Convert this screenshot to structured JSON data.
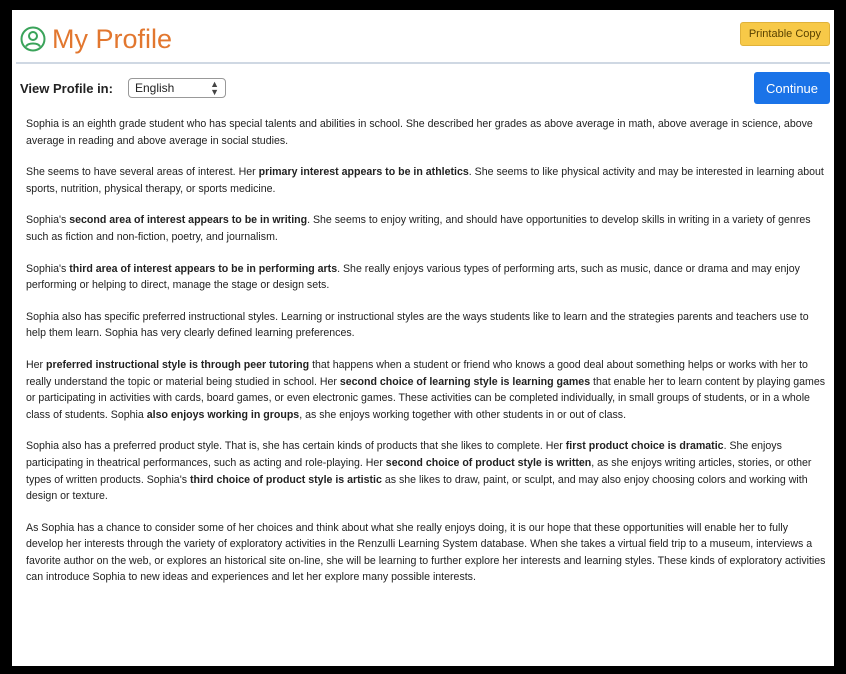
{
  "header": {
    "title": "My Profile",
    "printable_label": "Printable Copy",
    "title_color": "#e2772f",
    "icon": "user-circle-icon"
  },
  "toolbar": {
    "view_label": "View Profile in:",
    "language_selected": "English",
    "continue_label": "Continue",
    "continue_color": "#1a73e8"
  },
  "paragraphs": [
    [
      {
        "t": "Sophia is an eighth grade student who has special talents and abilities in school. She described her grades as above average in math, above average in science, above average in reading and above average in social studies."
      }
    ],
    [
      {
        "t": "She seems to have several areas of interest. Her "
      },
      {
        "t": "primary interest appears to be in athletics",
        "b": true
      },
      {
        "t": ". She seems to like physical activity and may be interested in learning about sports, nutrition, physical therapy, or sports medicine."
      }
    ],
    [
      {
        "t": "Sophia's "
      },
      {
        "t": "second area of interest appears to be in writing",
        "b": true
      },
      {
        "t": ". She seems to enjoy writing, and should have opportunities to develop skills in writing in a variety of genres such as fiction and non-fiction, poetry, and journalism."
      }
    ],
    [
      {
        "t": "Sophia's "
      },
      {
        "t": "third area of interest appears to be in performing arts",
        "b": true
      },
      {
        "t": ". She really enjoys various types of performing arts, such as music, dance or drama and may enjoy performing or helping to direct, manage the stage or design sets."
      }
    ],
    [
      {
        "t": "Sophia also has specific preferred instructional styles. Learning or instructional styles are the ways students like to learn and the strategies parents and teachers use to help them learn. Sophia has very clearly defined learning preferences."
      }
    ],
    [
      {
        "t": "Her "
      },
      {
        "t": "preferred instructional style is through peer tutoring",
        "b": true
      },
      {
        "t": " that happens when a student or friend who knows a good deal about something helps or works with her to really understand the topic or material being studied in school. Her "
      },
      {
        "t": "second choice of learning style is learning games",
        "b": true
      },
      {
        "t": " that enable her to learn content by playing games or participating in activities with cards, board games, or even electronic games. These activities can be completed individually, in small groups of students, or in a whole class of students. Sophia "
      },
      {
        "t": "also enjoys working in groups",
        "b": true
      },
      {
        "t": ", as she enjoys working together with other students in or out of class."
      }
    ],
    [
      {
        "t": "Sophia also has a preferred product style. That is, she has certain kinds of products that she likes to complete. Her "
      },
      {
        "t": "first product choice is dramatic",
        "b": true
      },
      {
        "t": ". She enjoys participating in theatrical performances, such as acting and role-playing. Her "
      },
      {
        "t": "second choice of product style is written",
        "b": true
      },
      {
        "t": ", as she enjoys writing articles, stories, or other types of written products. Sophia's "
      },
      {
        "t": "third choice of product style is artistic",
        "b": true
      },
      {
        "t": " as she likes to draw, paint, or sculpt, and may also enjoy choosing colors and working with design or texture."
      }
    ],
    [
      {
        "t": "As Sophia has a chance to consider some of her choices and think about what she really enjoys doing, it is our hope that these opportunities will enable her to fully develop her interests through the variety of exploratory activities in the Renzulli Learning System database. When she takes a virtual field trip to a museum, interviews a favorite author on the web, or explores an historical site on-line, she will be learning to further explore her interests and learning styles. These kinds of exploratory activities can introduce Sophia to new ideas and experiences and let her explore many possible interests."
      }
    ]
  ]
}
